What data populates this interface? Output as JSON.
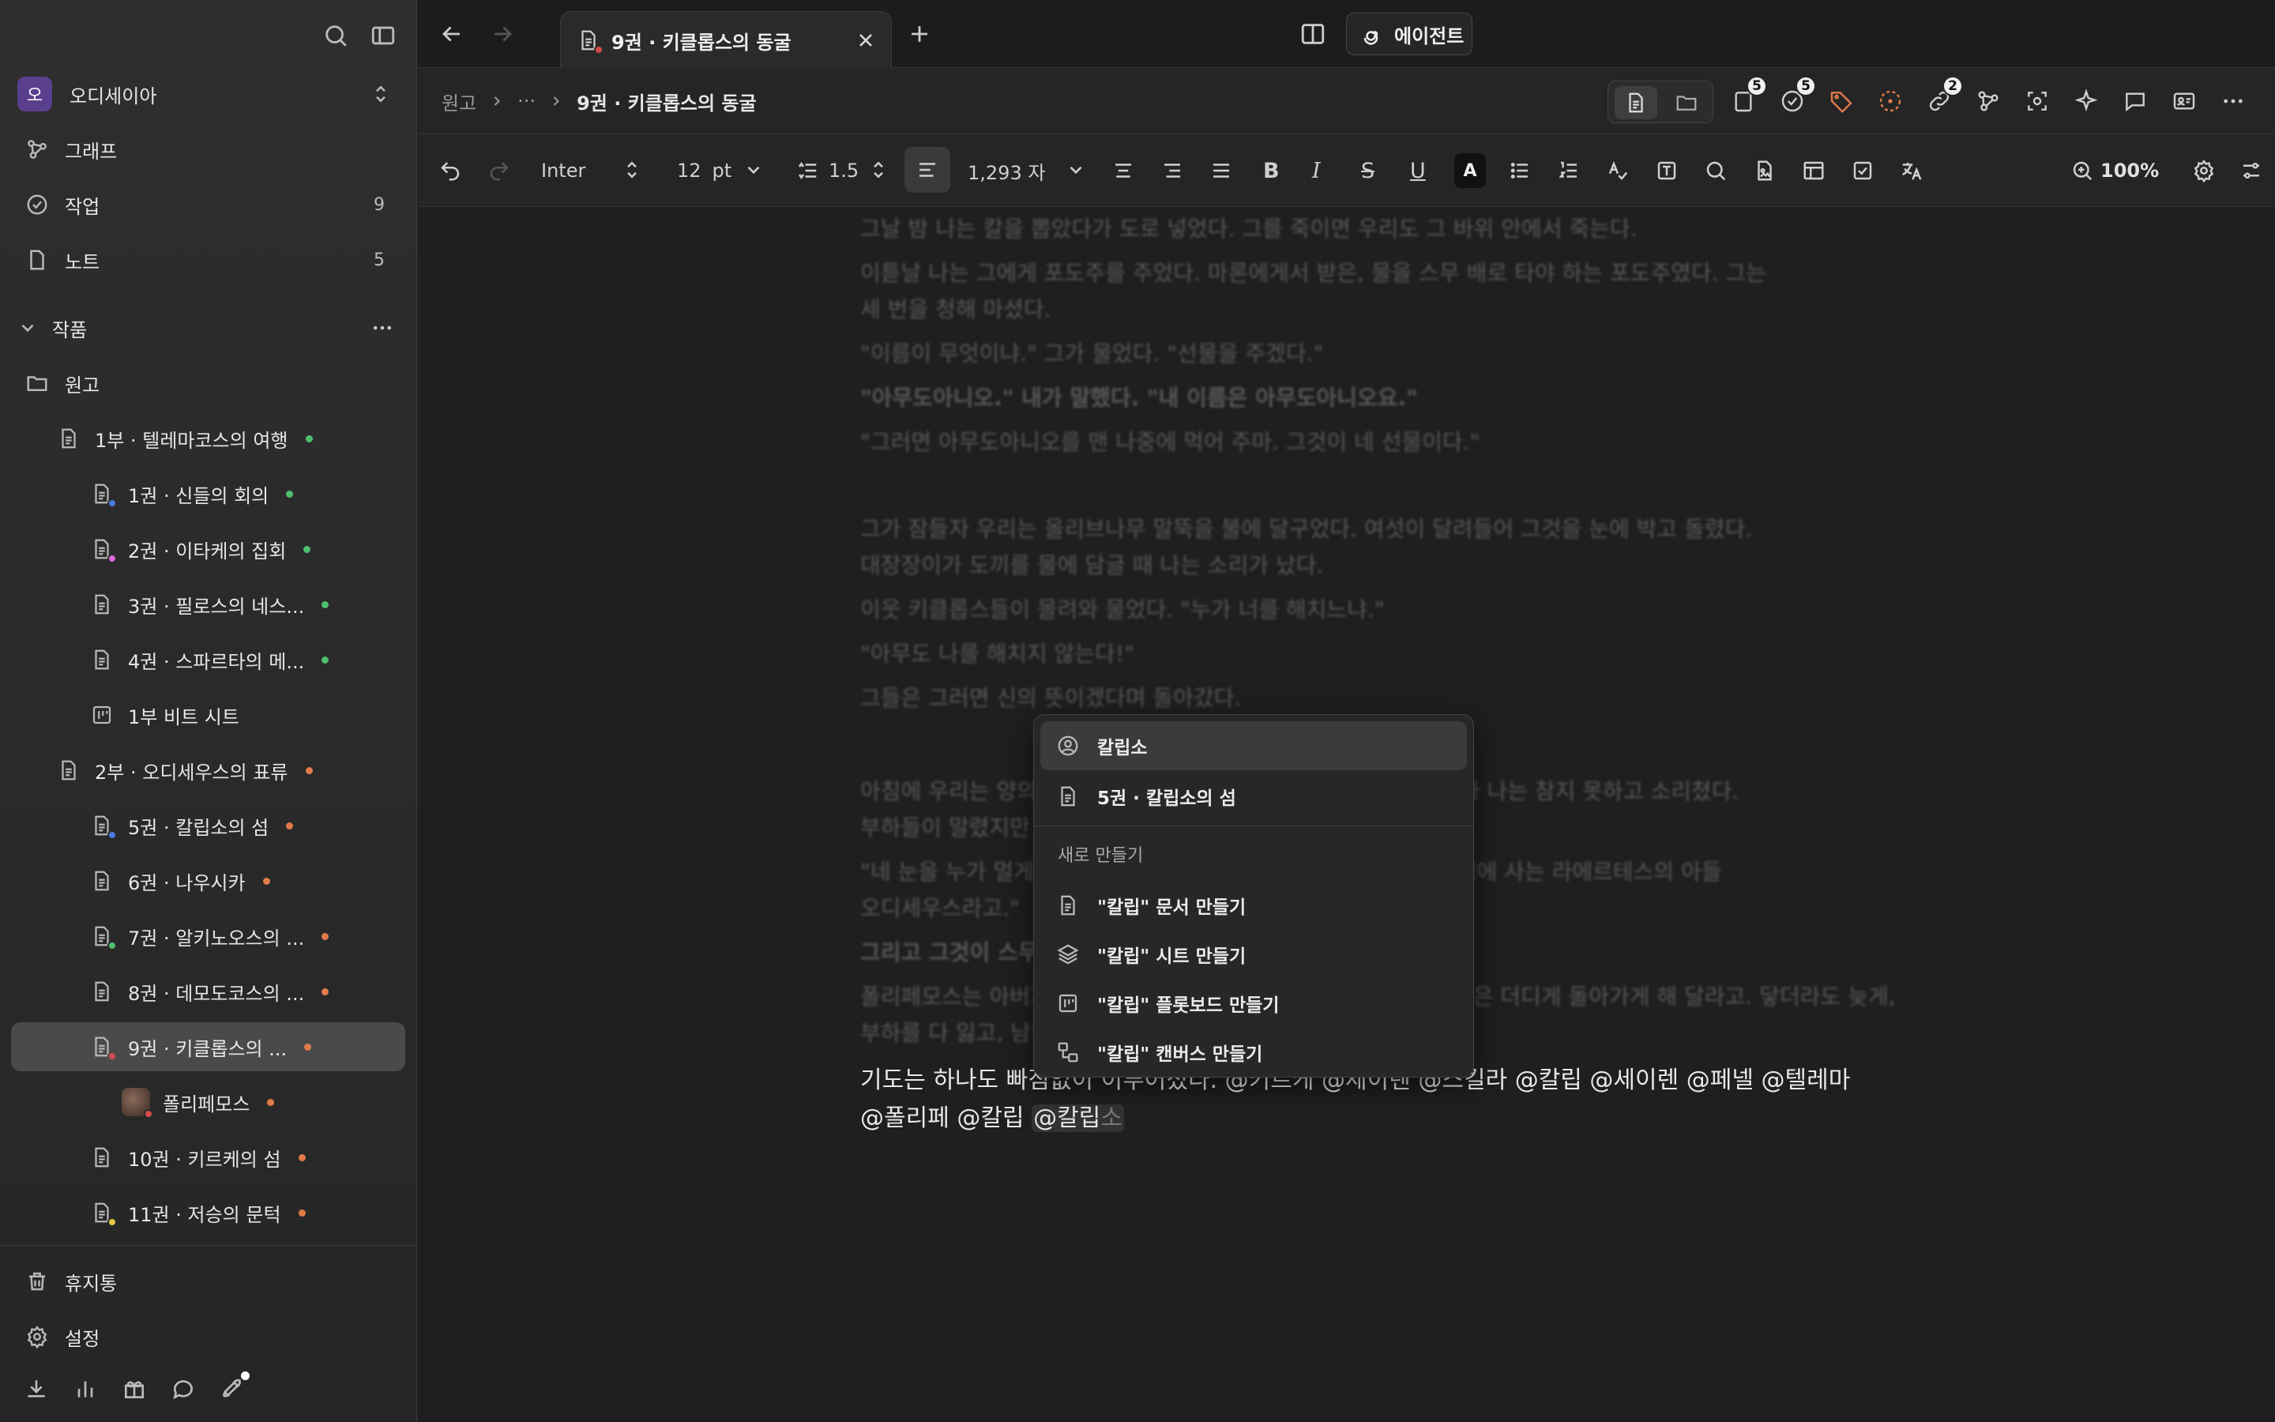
{
  "workspace": {
    "avatar_letter": "오",
    "name": "오디세이아"
  },
  "nav": [
    {
      "label": "그래프"
    },
    {
      "label": "작업",
      "count": "9"
    },
    {
      "label": "노트",
      "count": "5"
    }
  ],
  "section": {
    "title": "작품"
  },
  "tree": [
    {
      "label": "원고"
    },
    {
      "label": "1부 · 텔레마코스의 여행"
    },
    {
      "label": "1권 · 신들의 회의"
    },
    {
      "label": "2권 · 이타케의 집회"
    },
    {
      "label": "3권 · 필로스의 네스..."
    },
    {
      "label": "4권 · 스파르타의 메..."
    },
    {
      "label": "1부 비트 시트"
    },
    {
      "label": "2부 · 오디세우스의 표류"
    },
    {
      "label": "5권 · 칼립소의 섬"
    },
    {
      "label": "6권 · 나우시카"
    },
    {
      "label": "7권 · 알키노오스의 ..."
    },
    {
      "label": "8권 · 데모도코스의 ..."
    },
    {
      "label": "9권 · 키클롭스의 ..."
    },
    {
      "label": "폴리페모스"
    },
    {
      "label": "10권 · 키르케의 섬"
    },
    {
      "label": "11권 · 저승의 문턱"
    }
  ],
  "footer": {
    "trash": "휴지통",
    "settings": "설정"
  },
  "tab": {
    "title": "9권 · 키클롭스의 동굴"
  },
  "agent_button": "에이전트",
  "breadcrumb": {
    "root": "원고",
    "ellipsis": "···",
    "current": "9권 · 키클롭스의 동굴"
  },
  "badges": {
    "docs": "5",
    "tasks": "5",
    "links": "2"
  },
  "toolbar": {
    "font": "Inter",
    "size": "12",
    "unit": "pt",
    "line_height": "1.5",
    "word_count": "1,293 자",
    "zoom": "100%",
    "bold": "B",
    "italic": "I",
    "strike": "S",
    "underline": "U",
    "color_a": "A"
  },
  "editor": {
    "paragraphs": [
      "그날 밤 나는 칼을 뽑았다가 도로 넣었다. 그를 죽이면 우리도 그 바위 안에서 죽는다.",
      "이튿날 나는 그에게 포도주를 주었다. 마론에게서 받은, 물을 스무 배로 타야 하는 포도주였다. 그는",
      "세 번을 청해 마셨다.",
      "\"이름이 무엇이냐.\" 그가 물었다. \"선물을 주겠다.\"",
      "\"아무도아니오.\" 내가 말했다. \"내 이름은 아무도아니오요.\"",
      "\"그러면 아무도아니오를 맨 나중에 먹어 주마. 그것이 네 선물이다.\"",
      "그가 잠들자 우리는 올리브나무 말뚝을 불에 달구었다. 여섯이 달려들어 그것을 눈에 박고 돌렸다.",
      "대장장이가 도끼를 물에 담글 때 나는 소리가 났다.",
      "이웃 키클롭스들이 몰려와 물었다. \"누가 너를 해치느냐.\"",
      "\"아무도 나를 해치지 않는다!\"",
      "그들은 그러면 신의 뜻이겠다며 돌아갔다.",
      "아침에 우리는 양의 배 밑에 매달려 동굴을 빠져나왔다. 배에 오르자 나는 참지 못하고 소리쳤다.",
      "부하들이 말렸지만 나는 멈추지 않았다.",
      "\"네 눈을 누가 멀게 했느냐고 묻거든 말하라. 도시의 약탈자, 이타케에 사는 라에르테스의 아들",
      "오디세우스라고.\"",
      "그리고 그것이 스무 해의 시작이었다.",
      "폴리페모스는 아버지에게 기도했다. 그가 집에 돌아가지 못하게, 혹은 더디게 돌아가게 해 달라고. 닿더라도 늦게,",
      "부하를 다 잃고, 남의 배를 타고, 집에서 재앙을 만나게 해 달라고."
    ],
    "line1": "기도는 하나도 빠짐없이 이루어졌다. @키르케 @세이렌 @스킬라 @칼립 @세이렌 @페넬 @텔레마",
    "line2_prefix": "@폴리페 @칼립 ",
    "mention_typed": "@칼립",
    "mention_ghost": "소"
  },
  "popup": {
    "matches": [
      {
        "label": "칼립소"
      },
      {
        "label": "5권 · 칼립소의 섬"
      }
    ],
    "create_header": "새로 만들기",
    "create": [
      {
        "label": "\"칼립\" 문서 만들기"
      },
      {
        "label": "\"칼립\" 시트 만들기"
      },
      {
        "label": "\"칼립\" 플롯보드 만들기"
      },
      {
        "label": "\"칼립\" 캔버스 만들기"
      }
    ]
  },
  "colors": {
    "green_dot": "#4fbf6e",
    "orange_dot": "#e27a4a",
    "blue_sub": "#4a7be0",
    "pink_sub": "#d96bd9",
    "red_sub": "#d64b4b",
    "yellow_sub": "#e6c440"
  }
}
